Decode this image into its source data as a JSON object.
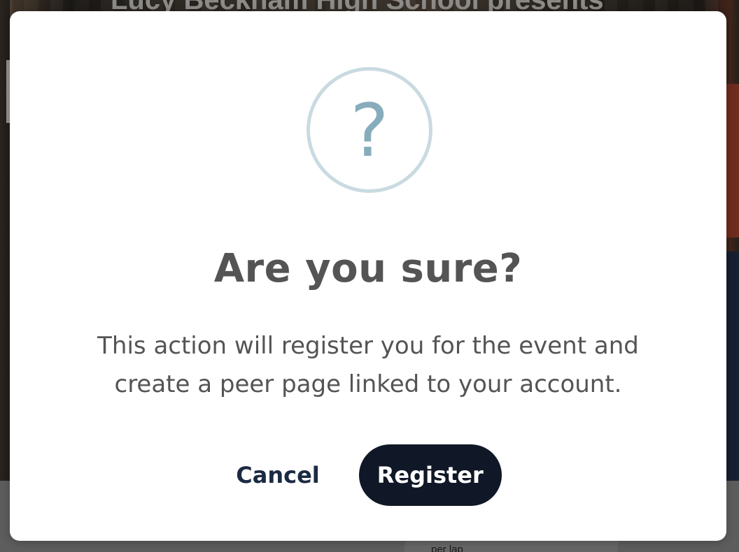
{
  "background": {
    "headline": "Lucy Beckham High School presents",
    "lower_text": "per lap"
  },
  "dialog": {
    "icon": "question-icon",
    "icon_glyph": "?",
    "title": "Are you sure?",
    "message": "This action will register you for the event and create a peer page linked to your account.",
    "cancel_label": "Cancel",
    "register_label": "Register"
  },
  "colors": {
    "icon_ring": "#c9dae1",
    "icon_glyph": "#87adbd",
    "text": "#545454",
    "cancel_text": "#1b2a44",
    "register_bg": "#101827",
    "register_text": "#ffffff"
  }
}
